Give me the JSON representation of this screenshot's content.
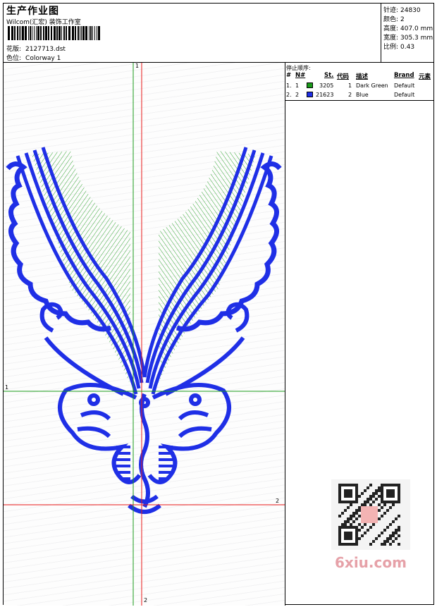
{
  "header": {
    "title": "生产作业图",
    "company": "Wilcom(汇宏) 装饰工作室",
    "design_label": "花版:",
    "design_file": "2127713.dst",
    "colorway_label": "色位:",
    "colorway_value": "Colorway 1"
  },
  "stats": [
    {
      "label": "针迹:",
      "value": "24830"
    },
    {
      "label": "颜色:",
      "value": "2"
    },
    {
      "label": "高度:",
      "value": "407.0 mm"
    },
    {
      "label": "宽度:",
      "value": "305.3 mm"
    },
    {
      "label": "比例:",
      "value": "0.43"
    }
  ],
  "legend": {
    "caption": "停止顺序:",
    "columns": [
      "#",
      "N#",
      "St.",
      "代码",
      "描述",
      "Brand",
      "元素"
    ],
    "rows": [
      {
        "index": "1.",
        "n": "1",
        "color": "#1a9a1a",
        "stitches": "3205",
        "code": "1",
        "desc": "Dark Green",
        "brand": "Default"
      },
      {
        "index": "2.",
        "n": "2",
        "color": "#1f2fe6",
        "stitches": "21623",
        "code": "2",
        "desc": "Blue",
        "brand": "Default"
      }
    ]
  },
  "axes": {
    "vertical_top": "1",
    "vertical_bottom": "2",
    "horizontal_left": "1",
    "horizontal_right": "2"
  },
  "colors": {
    "green": "#1a9a1a",
    "blue": "#1f2fe6",
    "red": "#e81818"
  },
  "watermark": "6xiu.com"
}
